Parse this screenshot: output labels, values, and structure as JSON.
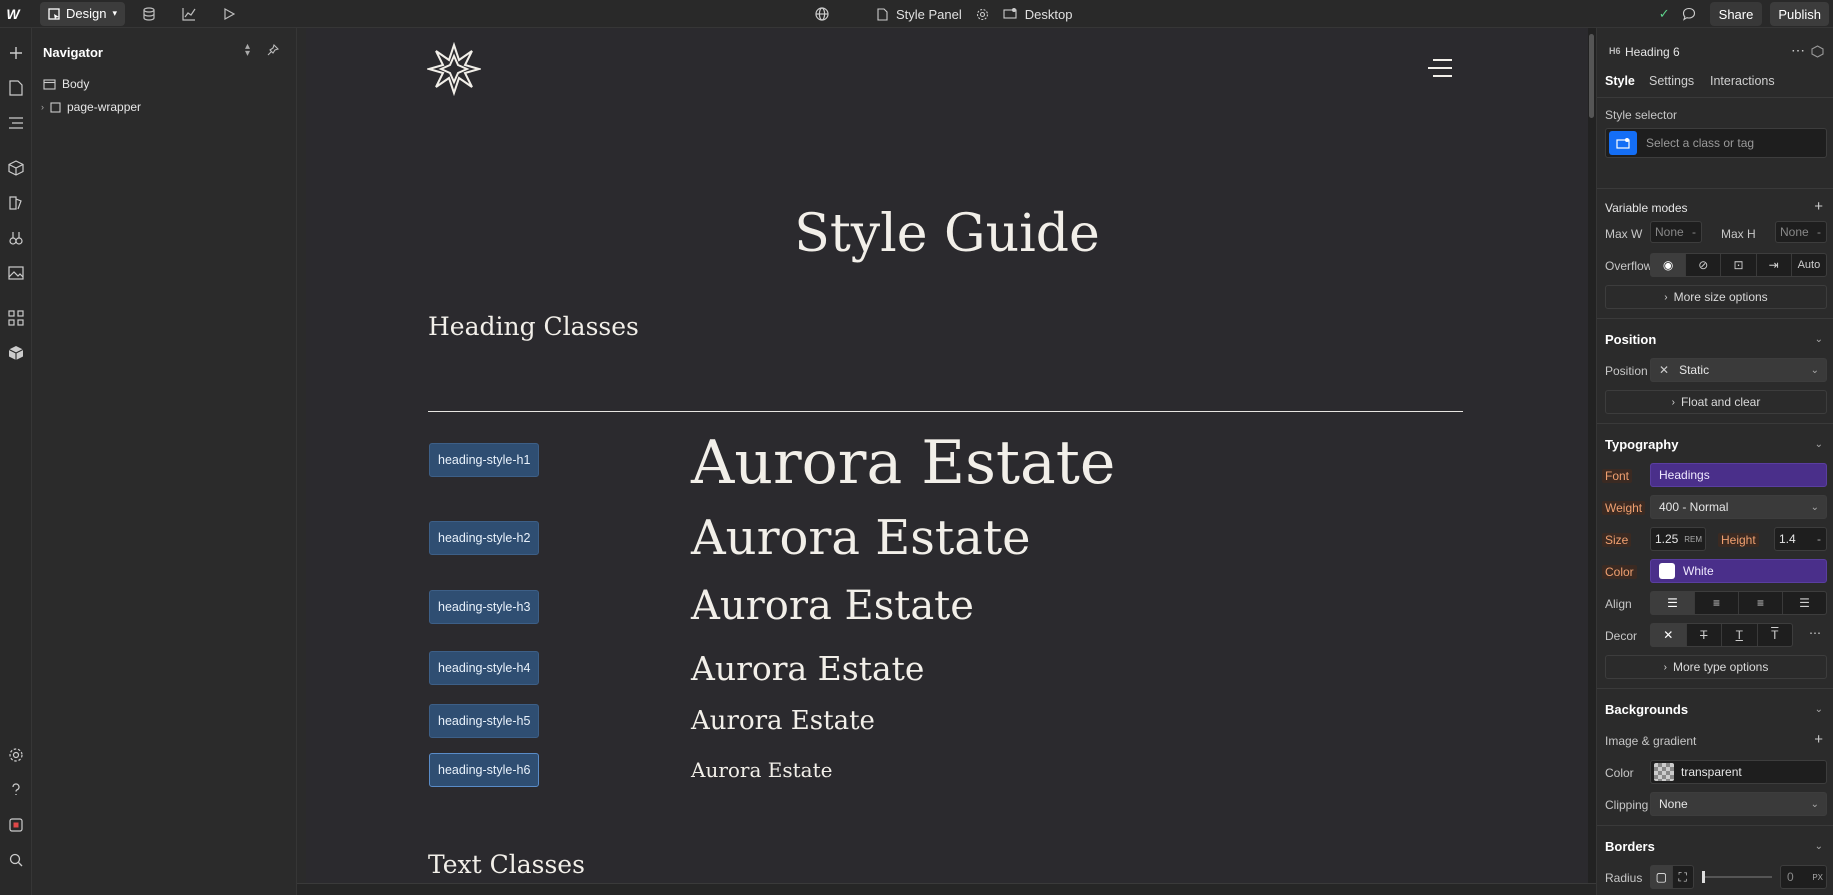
{
  "topbar": {
    "logo": "W",
    "mode": "Design",
    "style_panel": "Style Panel",
    "breakpoint": "Desktop",
    "share": "Share",
    "publish": "Publish"
  },
  "navigator": {
    "title": "Navigator",
    "tree": [
      {
        "label": "Body",
        "depth": 0
      },
      {
        "label": "page-wrapper",
        "depth": 1
      }
    ]
  },
  "canvas": {
    "page_title": "Style Guide",
    "section_heading": "Heading Classes",
    "next_section": "Text Classes",
    "heading_rows": [
      {
        "tag": "heading-style-h1",
        "sample": "Aurora Estate"
      },
      {
        "tag": "heading-style-h2",
        "sample": "Aurora Estate"
      },
      {
        "tag": "heading-style-h3",
        "sample": "Aurora Estate"
      },
      {
        "tag": "heading-style-h4",
        "sample": "Aurora Estate"
      },
      {
        "tag": "heading-style-h5",
        "sample": "Aurora Estate"
      },
      {
        "tag": "heading-style-h6",
        "sample": "Aurora Estate"
      }
    ]
  },
  "right_panel": {
    "element_badge": "H6",
    "element_name": "Heading 6",
    "tabs": [
      "Style",
      "Settings",
      "Interactions"
    ],
    "style_selector_label": "Style selector",
    "style_selector_placeholder": "Select a class or tag",
    "variable_modes": "Variable modes",
    "max_w_label": "Max W",
    "max_w_value": "None",
    "max_h_label": "Max H",
    "max_h_value": "None",
    "overflow_label": "Overflow",
    "overflow_auto": "Auto",
    "more_size": "More size options",
    "position_section": "Position",
    "position_label": "Position",
    "position_value": "Static",
    "float_clear": "Float and clear",
    "typography_section": "Typography",
    "font_label": "Font",
    "font_value": "Headings",
    "weight_label": "Weight",
    "weight_value": "400 - Normal",
    "size_label": "Size",
    "size_value": "1.25",
    "size_unit": "REM",
    "height_label": "Height",
    "height_value": "1.4",
    "color_label": "Color",
    "color_value": "White",
    "align_label": "Align",
    "decor_label": "Decor",
    "more_type": "More type options",
    "backgrounds_section": "Backgrounds",
    "image_gradient": "Image & gradient",
    "bg_color_label": "Color",
    "bg_color_value": "transparent",
    "clipping_label": "Clipping",
    "clipping_value": "None",
    "borders_section": "Borders",
    "radius_label": "Radius",
    "radius_value": "0",
    "radius_unit": "PX"
  },
  "colors": {
    "canvas_bg": "#2b2a2e",
    "tag_bg": "#2f4e72",
    "variable_purple": "#4a2f8a",
    "accent_blue": "#146ef5"
  }
}
